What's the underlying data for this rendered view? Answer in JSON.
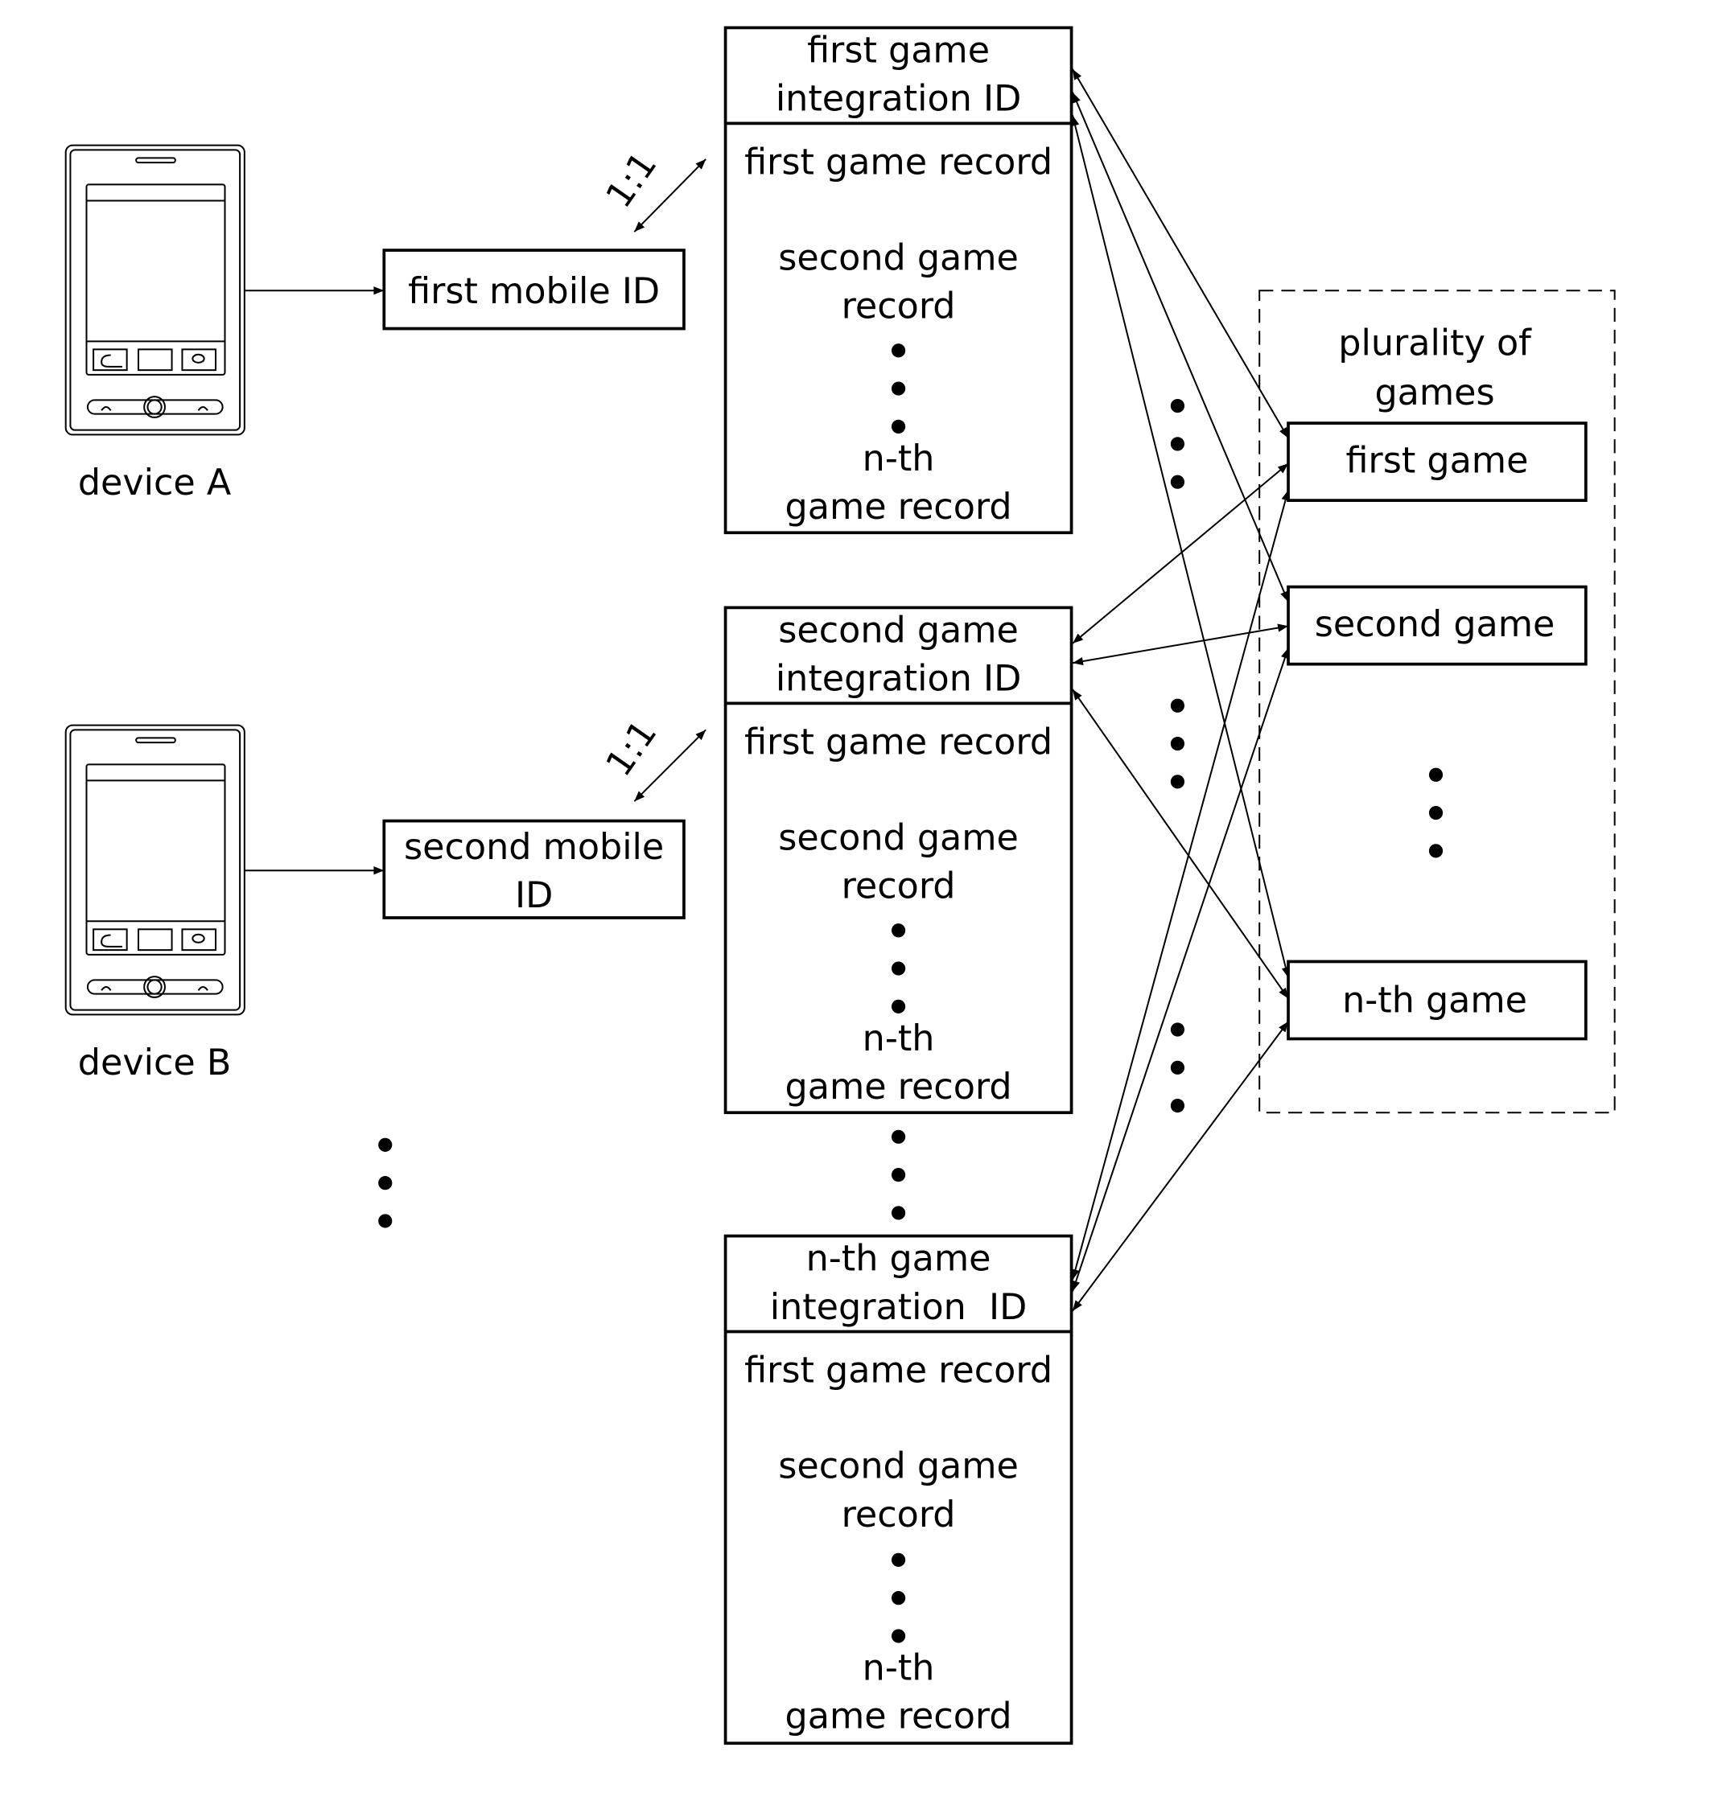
{
  "devices": [
    {
      "label": "device A",
      "mobile_id": [
        "first mobile ID"
      ]
    },
    {
      "label": "device B",
      "mobile_id": [
        "second mobile",
        "ID"
      ]
    }
  ],
  "relation_label": "1:1",
  "integration_boxes": [
    {
      "header": [
        "first game",
        "integration ID"
      ],
      "records": {
        "first": "first game record",
        "second": [
          "second game",
          "record"
        ],
        "nth": [
          "n-th",
          "game record"
        ]
      }
    },
    {
      "header": [
        "second game",
        "integration ID"
      ],
      "records": {
        "first": "first game record",
        "second": [
          "second game",
          "record"
        ],
        "nth": [
          "n-th",
          "game record"
        ]
      }
    },
    {
      "header": [
        "n-th game",
        "integration  ID"
      ],
      "records": {
        "first": "first game record",
        "second": [
          "second game",
          "record"
        ],
        "nth": [
          "n-th",
          "game record"
        ]
      }
    }
  ],
  "games_group": {
    "title": [
      "plurality of",
      "games"
    ],
    "games": [
      "first game",
      "second game",
      "n-th game"
    ]
  }
}
